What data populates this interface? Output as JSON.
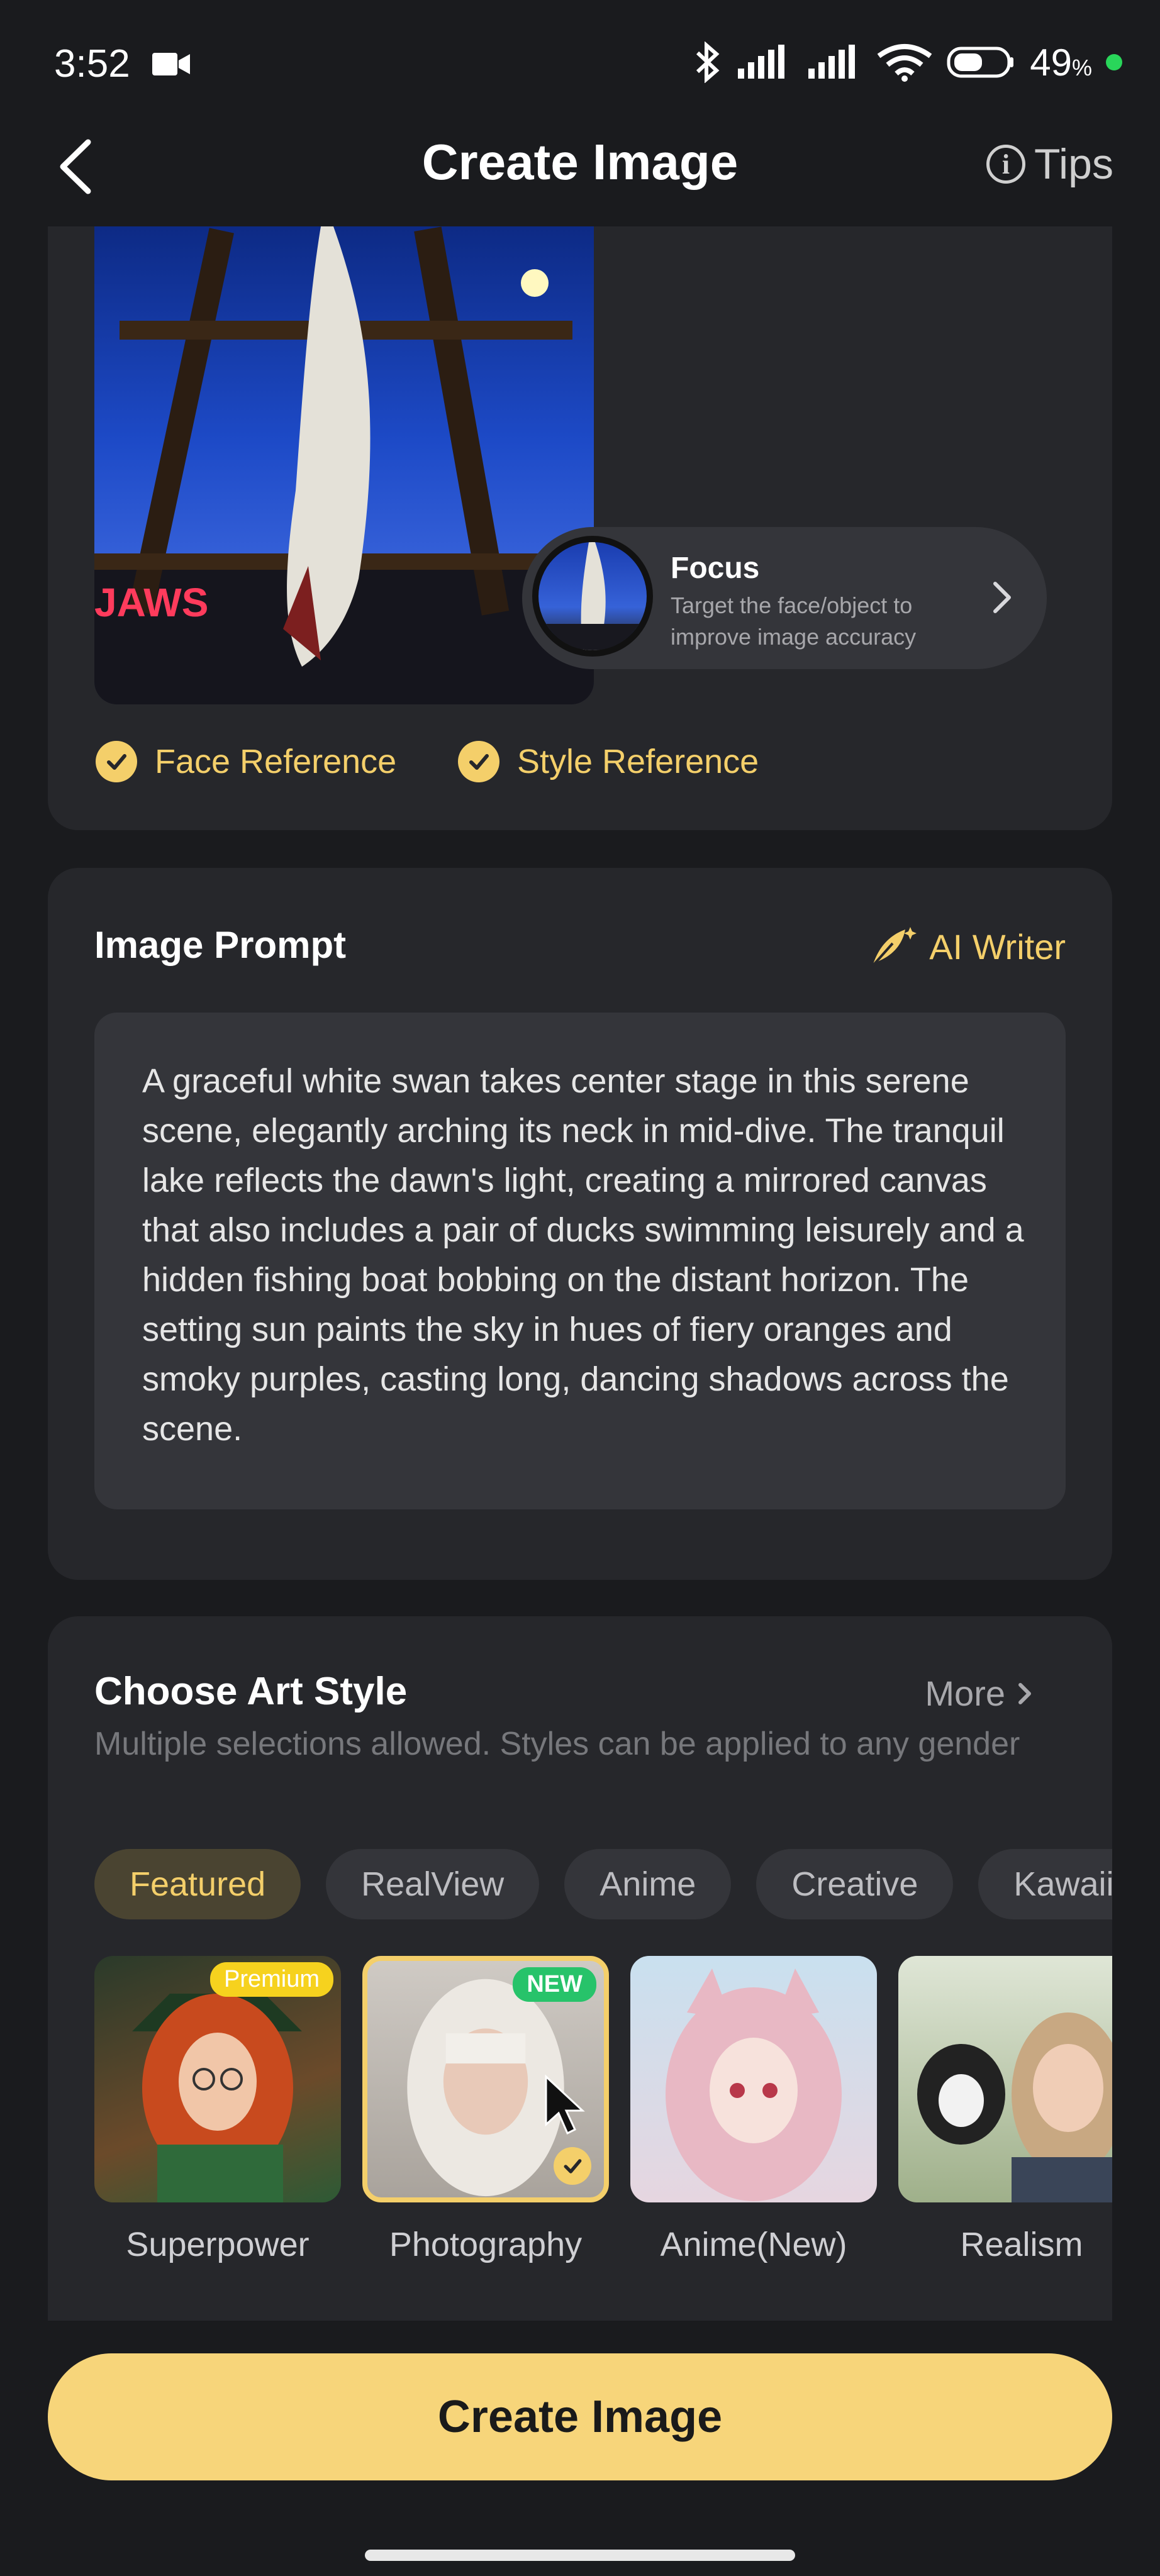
{
  "status_bar": {
    "time": "3:52",
    "battery": "49",
    "battery_suffix": "%"
  },
  "header": {
    "title": "Create Image",
    "tips_label": "Tips"
  },
  "reference": {
    "sign_text": "JAWS",
    "focus_title": "Focus",
    "focus_subtitle": "Target the face/object to improve image accuracy",
    "checks": [
      "Face Reference",
      "Style Reference"
    ]
  },
  "prompt": {
    "title": "Image Prompt",
    "ai_writer": "AI Writer",
    "text": "A graceful white swan takes center stage in this serene scene, elegantly arching its neck in mid-dive. The tranquil lake reflects the dawn's light, creating a mirrored canvas that also includes a pair of ducks swimming leisurely and a hidden fishing boat bobbing on the distant horizon. The setting sun paints the sky in hues of fiery oranges and smoky purples, casting long, dancing shadows across the scene."
  },
  "art_style": {
    "title": "Choose Art Style",
    "more": "More",
    "subtitle": "Multiple selections allowed. Styles can be applied to any gender",
    "tabs": [
      "Featured",
      "RealView",
      "Anime",
      "Creative",
      "Kawaii"
    ],
    "active_tab": "Featured",
    "styles": [
      {
        "label": "Superpower",
        "badge": "Premium"
      },
      {
        "label": "Photography",
        "badge": "NEW",
        "selected": true
      },
      {
        "label": "Anime(New)",
        "badge": ""
      },
      {
        "label": "Realism",
        "badge": ""
      }
    ]
  },
  "cta": {
    "label": "Create Image"
  },
  "colors": {
    "accent": "#f4cf6a",
    "cta": "#f7d57a",
    "background": "#1a1b1e",
    "card": "#26272b"
  }
}
